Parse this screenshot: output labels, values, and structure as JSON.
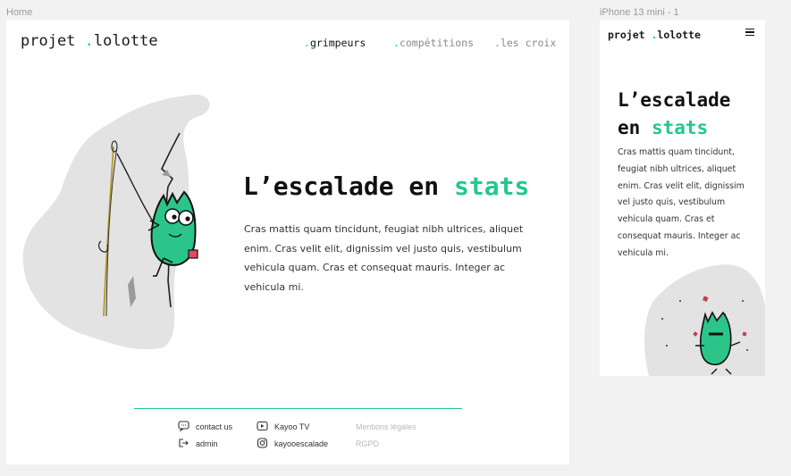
{
  "frames": {
    "desktop_label": "Home",
    "mobile_label": "iPhone 13 mini - 1"
  },
  "logo": {
    "prefix": "projet ",
    "dot": ".",
    "suffix": "lolotte"
  },
  "nav": [
    {
      "dot": ".",
      "label": "grimpeurs",
      "active": true
    },
    {
      "dot": ".",
      "label": "compétitions",
      "active": false
    },
    {
      "dot": ".",
      "label": "les croix",
      "active": false
    }
  ],
  "hero": {
    "title_main": "L’escalade en ",
    "title_line1": "L’escalade",
    "title_en": "en ",
    "title_accent": "stats",
    "text": "Cras mattis quam tincidunt, feugiat nibh ultrices, aliquet enim. Cras velit elit, dignissim vel justo quis, vestibulum vehicula quam. Cras et consequat mauris. Integer ac vehicula mi."
  },
  "footer": {
    "contact": "contact us",
    "admin": "admin",
    "tv": "Kayoo TV",
    "insta": "kayooescalade",
    "legal": "Mentions légales",
    "rgpd": "RGPD"
  },
  "colors": {
    "accent": "#22c98b",
    "blob": "#e3e3e3",
    "character": "#2bc58a"
  },
  "icons": {
    "menu": "hamburger-icon",
    "contact": "chat-bubble-icon",
    "admin": "logout-icon",
    "tv": "play-icon",
    "insta": "instagram-icon"
  }
}
